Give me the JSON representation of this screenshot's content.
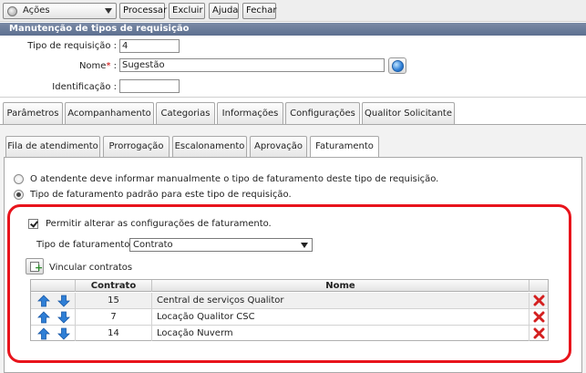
{
  "toolbar": {
    "actions_label": "Ações",
    "buttons": [
      "Processar",
      "Excluir",
      "Ajuda",
      "Fechar"
    ]
  },
  "header": {
    "title": "Manutenção de tipos de requisição"
  },
  "form": {
    "tipo_label": "Tipo de requisição :",
    "tipo_value": "4",
    "nome_label": "Nome",
    "nome_required": "*",
    "nome_colon": ":",
    "nome_value": "Sugestão",
    "ident_label": "Identificação :",
    "ident_value": ""
  },
  "main_tabs": [
    "Parâmetros",
    "Acompanhamento",
    "Categorias",
    "Informações",
    "Configurações",
    "Qualitor Solicitante"
  ],
  "main_tab_active": "Configurações",
  "sub_tabs": [
    "Fila de atendimento",
    "Prorrogação",
    "Escalonamento",
    "Aprovação",
    "Faturamento"
  ],
  "sub_tab_active": "Faturamento",
  "billing": {
    "radio_manual": "O atendente deve informar manualmente o tipo de faturamento deste tipo de requisição.",
    "radio_default": "Tipo de faturamento padrão para este tipo de requisição.",
    "selected_radio": "default",
    "allow_change_label": "Permitir alterar as configurações de faturamento.",
    "allow_change_checked": true,
    "tipo_fat_label": "Tipo de faturamento :",
    "tipo_fat_value": "Contrato",
    "link_contracts_label": "Vincular contratos"
  },
  "contracts_table": {
    "headers": {
      "contrato": "Contrato",
      "nome": "Nome"
    },
    "rows": [
      {
        "contrato": "15",
        "nome": "Central de serviços Qualitor"
      },
      {
        "contrato": "7",
        "nome": "Locação Qualitor CSC"
      },
      {
        "contrato": "14",
        "nome": "Locação Nuverm"
      }
    ]
  },
  "colors": {
    "title_bar": "#6a7b9c",
    "highlight": "#e8141c",
    "arrow_blue": "#2f7fd6",
    "delete_red": "#d42020"
  }
}
